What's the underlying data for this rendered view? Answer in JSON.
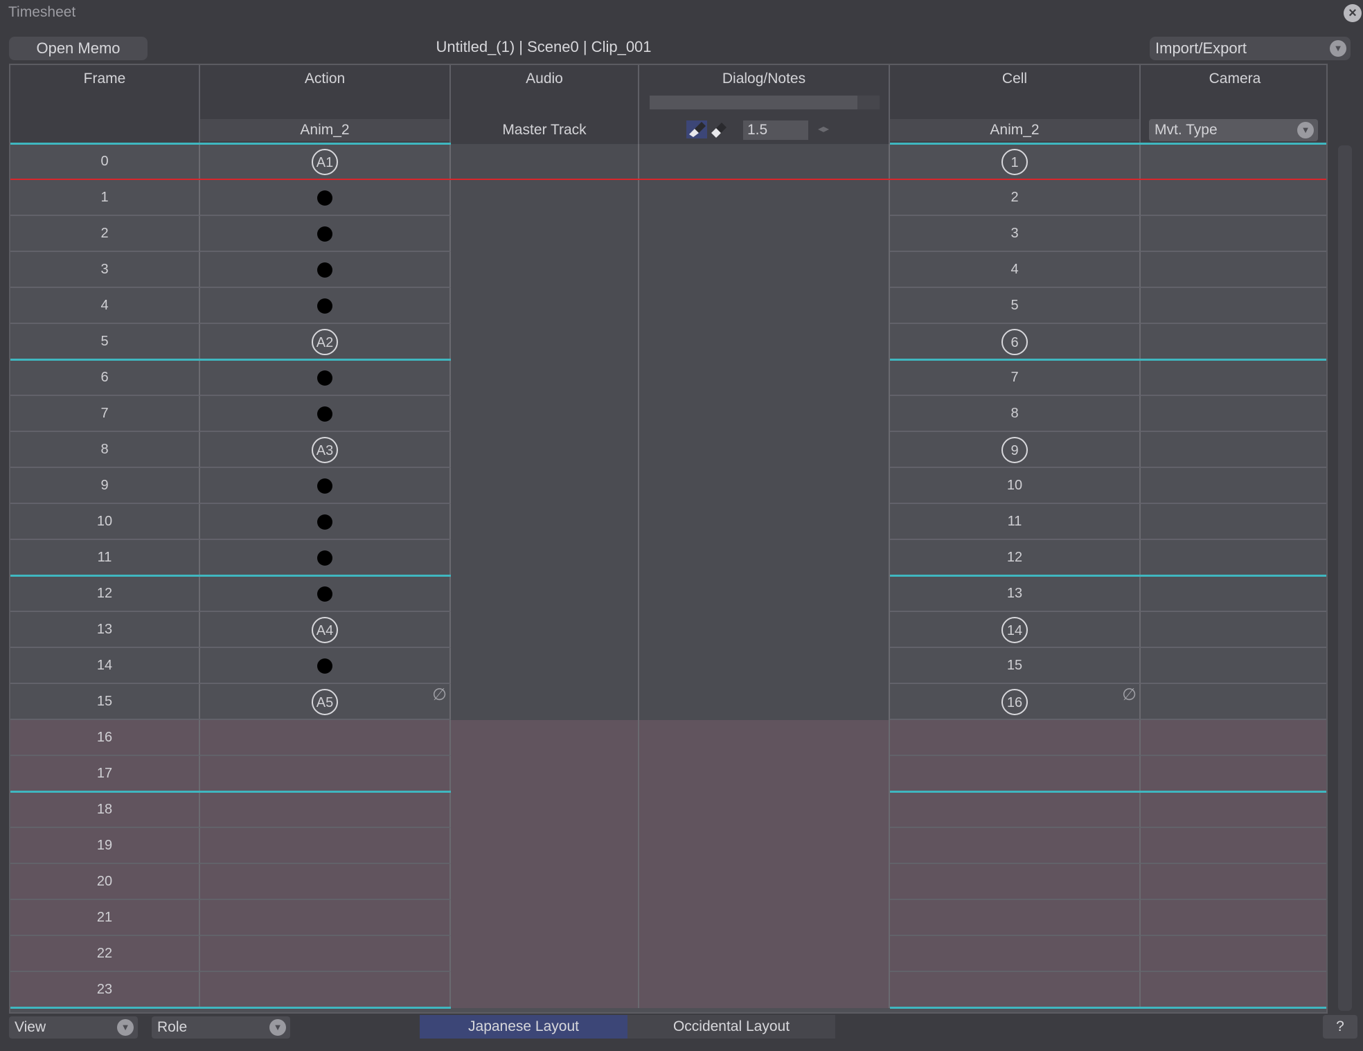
{
  "window": {
    "title": "Timesheet"
  },
  "toolbar": {
    "open_memo": "Open Memo",
    "clip_title": "Untitled_(1) | Scene0 | Clip_001",
    "import_export": "Import/Export"
  },
  "columns": {
    "frame": {
      "title": "Frame"
    },
    "action": {
      "title": "Action",
      "layer": "Anim_2"
    },
    "audio": {
      "title": "Audio",
      "track": "Master Track"
    },
    "dialog": {
      "title": "Dialog/Notes",
      "scale": "1.5"
    },
    "cell": {
      "title": "Cell",
      "layer": "Anim_2"
    },
    "camera": {
      "title": "Camera",
      "movement_type": "Mvt. Type"
    }
  },
  "rows": [
    {
      "frame": "0",
      "action": "A1",
      "action_type": "key",
      "cell": "1",
      "cell_type": "key",
      "clip": true
    },
    {
      "frame": "1",
      "action": "",
      "action_type": "dot",
      "cell": "2",
      "cell_type": "plain",
      "clip": true
    },
    {
      "frame": "2",
      "action": "",
      "action_type": "dot",
      "cell": "3",
      "cell_type": "plain",
      "clip": true
    },
    {
      "frame": "3",
      "action": "",
      "action_type": "dot",
      "cell": "4",
      "cell_type": "plain",
      "clip": true
    },
    {
      "frame": "4",
      "action": "",
      "action_type": "dot",
      "cell": "5",
      "cell_type": "plain",
      "clip": true
    },
    {
      "frame": "5",
      "action": "A2",
      "action_type": "key",
      "cell": "6",
      "cell_type": "key",
      "clip": true
    },
    {
      "frame": "6",
      "action": "",
      "action_type": "dot",
      "cell": "7",
      "cell_type": "plain",
      "clip": true
    },
    {
      "frame": "7",
      "action": "",
      "action_type": "dot",
      "cell": "8",
      "cell_type": "plain",
      "clip": true
    },
    {
      "frame": "8",
      "action": "A3",
      "action_type": "key",
      "cell": "9",
      "cell_type": "key",
      "clip": true
    },
    {
      "frame": "9",
      "action": "",
      "action_type": "dot",
      "cell": "10",
      "cell_type": "plain",
      "clip": true
    },
    {
      "frame": "10",
      "action": "",
      "action_type": "dot",
      "cell": "11",
      "cell_type": "plain",
      "clip": true
    },
    {
      "frame": "11",
      "action": "",
      "action_type": "dot",
      "cell": "12",
      "cell_type": "plain",
      "clip": true
    },
    {
      "frame": "12",
      "action": "",
      "action_type": "dot",
      "cell": "13",
      "cell_type": "plain",
      "clip": true
    },
    {
      "frame": "13",
      "action": "A4",
      "action_type": "key",
      "cell": "14",
      "cell_type": "key",
      "clip": true
    },
    {
      "frame": "14",
      "action": "",
      "action_type": "dot",
      "cell": "15",
      "cell_type": "plain",
      "clip": true
    },
    {
      "frame": "15",
      "action": "A5",
      "action_type": "key",
      "cell": "16",
      "cell_type": "key",
      "clip": true,
      "end_marker": true
    },
    {
      "frame": "16",
      "action": "",
      "action_type": "none",
      "cell": "",
      "cell_type": "none",
      "clip": false
    },
    {
      "frame": "17",
      "action": "",
      "action_type": "none",
      "cell": "",
      "cell_type": "none",
      "clip": false
    },
    {
      "frame": "18",
      "action": "",
      "action_type": "none",
      "cell": "",
      "cell_type": "none",
      "clip": false
    },
    {
      "frame": "19",
      "action": "",
      "action_type": "none",
      "cell": "",
      "cell_type": "none",
      "clip": false
    },
    {
      "frame": "20",
      "action": "",
      "action_type": "none",
      "cell": "",
      "cell_type": "none",
      "clip": false
    },
    {
      "frame": "21",
      "action": "",
      "action_type": "none",
      "cell": "",
      "cell_type": "none",
      "clip": false
    },
    {
      "frame": "22",
      "action": "",
      "action_type": "none",
      "cell": "",
      "cell_type": "none",
      "clip": false
    },
    {
      "frame": "23",
      "action": "",
      "action_type": "none",
      "cell": "",
      "cell_type": "none",
      "clip": false
    }
  ],
  "current_frame": 0,
  "section_every": 6,
  "end_marker_symbol": "∅",
  "bottom": {
    "view": "View",
    "role": "Role",
    "japanese_layout": "Japanese Layout",
    "occidental_layout": "Occidental Layout",
    "help": "?"
  },
  "colors": {
    "background": "#3c3c41",
    "clip_row": "#4f5056",
    "out_of_range_row": "#61545e",
    "audio_dialog_clip": "#4b4c52",
    "section_line": "#3fb7c0",
    "current_frame_line": "#d9262b",
    "active_tab": "#3c4677"
  },
  "icons": {
    "close": "close-icon",
    "dropdown": "chevron-down-icon",
    "end_marker": "empty-set-icon"
  }
}
